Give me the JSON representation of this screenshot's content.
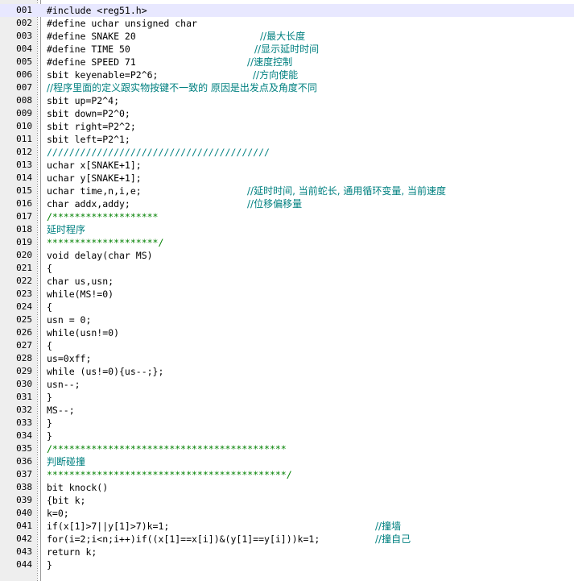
{
  "editor": {
    "lines": [
      {
        "num": "001",
        "code": "#include <reg51.h>",
        "comment": ""
      },
      {
        "num": "002",
        "code": "#define uchar unsigned char",
        "comment": ""
      },
      {
        "num": "003",
        "code": "#define SNAKE 20",
        "comment": "//最大长度"
      },
      {
        "num": "004",
        "code": "#define TIME 50",
        "comment": "//显示延时时间"
      },
      {
        "num": "005",
        "code": "#define SPEED 71",
        "comment": "//速度控制"
      },
      {
        "num": "006",
        "code": "sbit keyenable=P2^6;",
        "comment": "//方向使能"
      },
      {
        "num": "007",
        "code": "//程序里面的定义跟实物按键不一致的 原因是出发点及角度不同",
        "comment": ""
      },
      {
        "num": "008",
        "code": "sbit up=P2^4;",
        "comment": ""
      },
      {
        "num": "009",
        "code": "sbit down=P2^0;",
        "comment": ""
      },
      {
        "num": "010",
        "code": "sbit right=P2^2;",
        "comment": ""
      },
      {
        "num": "011",
        "code": "sbit left=P2^1;",
        "comment": ""
      },
      {
        "num": "012",
        "code": "////////////////////////////////////////",
        "comment": ""
      },
      {
        "num": "013",
        "code": "uchar x[SNAKE+1];",
        "comment": ""
      },
      {
        "num": "014",
        "code": "uchar y[SNAKE+1];",
        "comment": ""
      },
      {
        "num": "015",
        "code": "uchar time,n,i,e;",
        "comment": "//延时时间, 当前蛇长, 通用循环变量, 当前速度"
      },
      {
        "num": "016",
        "code": "char addx,addy;",
        "comment": "//位移偏移量"
      },
      {
        "num": "017",
        "code": "/*******************",
        "comment": ""
      },
      {
        "num": "018",
        "code": "延时程序",
        "comment": ""
      },
      {
        "num": "019",
        "code": "********************/",
        "comment": ""
      },
      {
        "num": "020",
        "code": "void delay(char MS)",
        "comment": ""
      },
      {
        "num": "021",
        "code": "{",
        "comment": ""
      },
      {
        "num": "022",
        "code": "char us,usn;",
        "comment": ""
      },
      {
        "num": "023",
        "code": "while(MS!=0)",
        "comment": ""
      },
      {
        "num": "024",
        "code": "{",
        "comment": ""
      },
      {
        "num": "025",
        "code": "usn = 0;",
        "comment": ""
      },
      {
        "num": "026",
        "code": "while(usn!=0)",
        "comment": ""
      },
      {
        "num": "027",
        "code": "{",
        "comment": ""
      },
      {
        "num": "028",
        "code": "us=0xff;",
        "comment": ""
      },
      {
        "num": "029",
        "code": "while (us!=0){us--;};",
        "comment": ""
      },
      {
        "num": "030",
        "code": "usn--;",
        "comment": ""
      },
      {
        "num": "031",
        "code": "}",
        "comment": ""
      },
      {
        "num": "032",
        "code": "MS--;",
        "comment": ""
      },
      {
        "num": "033",
        "code": "}",
        "comment": ""
      },
      {
        "num": "034",
        "code": "}",
        "comment": ""
      },
      {
        "num": "035",
        "code": "/******************************************",
        "comment": ""
      },
      {
        "num": "036",
        "code": "判断碰撞",
        "comment": ""
      },
      {
        "num": "037",
        "code": "*******************************************/",
        "comment": ""
      },
      {
        "num": "038",
        "code": "bit knock()",
        "comment": ""
      },
      {
        "num": "039",
        "code": "{bit k;",
        "comment": ""
      },
      {
        "num": "040",
        "code": "k=0;",
        "comment": ""
      },
      {
        "num": "041",
        "code": "if(x[1]>7||y[1]>7)k=1;",
        "comment": "//撞墙"
      },
      {
        "num": "042",
        "code": "for(i=2;i<n;i++)if((x[1]==x[i])&(y[1]==y[i]))k=1;",
        "comment": "//撞自己"
      },
      {
        "num": "043",
        "code": "return k;",
        "comment": ""
      },
      {
        "num": "044",
        "code": "}",
        "comment": ""
      }
    ]
  }
}
